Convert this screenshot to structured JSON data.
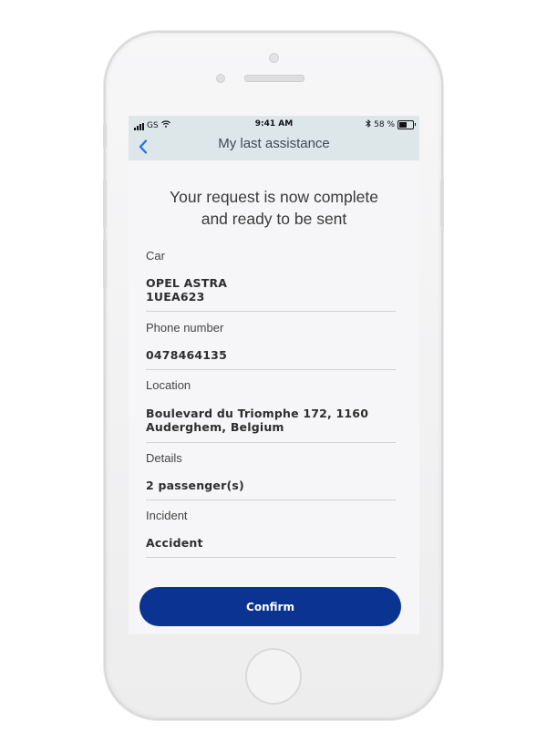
{
  "status_bar": {
    "carrier": "GS",
    "time": "9:41 AM",
    "battery": "58 %",
    "battery_level": 0.58
  },
  "nav": {
    "back_icon": "chevron-left-icon",
    "title": "My last assistance"
  },
  "headline": "Your request is now complete\nand ready to be sent",
  "fields": [
    {
      "label": "Car",
      "value": "OPEL ASTRA\n1UEA623"
    },
    {
      "label": "Phone number",
      "value": "0478464135"
    },
    {
      "label": "Location",
      "value": "Boulevard du Triomphe 172, 1160\nAuderghem, Belgium"
    },
    {
      "label": "Details",
      "value": "2 passenger(s)"
    },
    {
      "label": "Incident",
      "value": "Accident"
    }
  ],
  "confirm_label": "Confirm",
  "colors": {
    "accent": "#0b3392",
    "nav_background": "#dde7ea",
    "back_arrow": "#1a73e8"
  }
}
